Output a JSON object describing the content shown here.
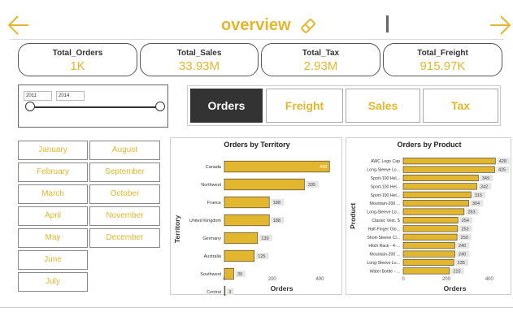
{
  "header": {
    "title": "overview",
    "prev_icon": "arrow-left-icon",
    "next_icon": "arrow-right-icon",
    "title_icon": "eraser-icon",
    "accent_color": "#e2b72f",
    "dark_color": "#333333"
  },
  "kpis": [
    {
      "label": "Total_Orders",
      "value": "1K"
    },
    {
      "label": "Total_Sales",
      "value": "33.93M"
    },
    {
      "label": "Total_Tax",
      "value": "2.93M"
    },
    {
      "label": "Total_Freight",
      "value": "915.97K"
    }
  ],
  "date_slicer": {
    "start": "2011",
    "end": "2014",
    "range_start": 0,
    "range_end": 1
  },
  "nav": {
    "buttons": [
      "Orders",
      "Freight",
      "Sales",
      "Tax"
    ],
    "active": "Orders"
  },
  "months": {
    "left": [
      "January",
      "February",
      "March",
      "April",
      "May",
      "June",
      "July"
    ],
    "right": [
      "August",
      "September",
      "October",
      "November",
      "December"
    ]
  },
  "chart_data": [
    {
      "type": "bar",
      "orientation": "horizontal",
      "title": "Orders by Territory",
      "xlabel": "Orders",
      "ylabel": "Territory",
      "xlim": [
        0,
        480
      ],
      "xticks": [
        0,
        200,
        400
      ],
      "categories": [
        "Canada",
        "Northwest",
        "France",
        "United Kingdom",
        "Germany",
        "Australia",
        "Southwest",
        "Central"
      ],
      "values": [
        440,
        335,
        188,
        188,
        139,
        125,
        39,
        3
      ],
      "data_labels": [
        "440",
        "335",
        "188",
        "188",
        "139",
        "125",
        "39",
        "3"
      ],
      "bar_color": "#e2b72f"
    },
    {
      "type": "bar",
      "orientation": "horizontal",
      "title": "Orders by Product",
      "xlabel": "Orders",
      "ylabel": "Product",
      "xlim": [
        0,
        480
      ],
      "xticks": [
        0,
        200,
        400
      ],
      "categories": [
        "AWC Logo Cap",
        "Long-Sleeve Lo...",
        "Sport-100 Hel...",
        "Sport-100 Hel...",
        "Sport-100 Hel...",
        "Mountain-200 ...",
        "Long-Sleeve Lo...",
        "Classic Vest, S",
        "Half-Finger Glo...",
        "Short-Sleeve Cl...",
        "Hitch Rack - 4-...",
        "Mountain-200 ...",
        "Long-Sleeve Lo...",
        "Water Bottle - ..."
      ],
      "values": [
        428,
        425,
        349,
        342,
        315,
        304,
        283,
        254,
        253,
        250,
        240,
        240,
        235,
        215
      ],
      "data_labels": [
        "428",
        "425",
        "349",
        "342",
        "315",
        "304",
        "283",
        "254",
        "253",
        "250",
        "240",
        "240",
        "235",
        "215"
      ],
      "bar_color": "#e2b72f"
    }
  ]
}
